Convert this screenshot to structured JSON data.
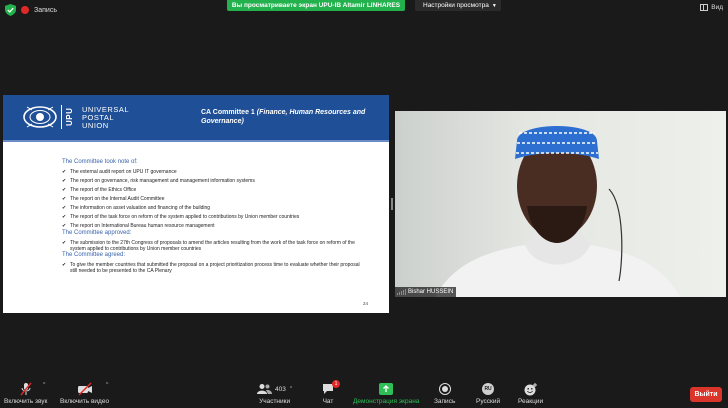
{
  "topbar": {
    "record_label": "Запись",
    "share_banner": "Вы просматриваете экран UPU-IB Altamir LINHARES",
    "view_options": "Настройки просмотра",
    "view_label": "Вид"
  },
  "slide": {
    "logo_abbr": "UPU",
    "logo_name_lines": [
      "UNIVERSAL",
      "POSTAL",
      "UNION"
    ],
    "title_main": "CA Committee 1 ",
    "title_sub": "(Finance, Human Resources and Governance)",
    "sections": [
      {
        "heading": "The Committee took note of:",
        "items": [
          "The external audit report on UPU IT governance",
          "The report on governance, risk management and management information systems",
          "The report of the Ethics Office",
          "The report on the Internal Audit Committee",
          "The information on asset valuation and financing of the building",
          "The report of the task force on reform of the system applied to contributions by Union member countries",
          "The report on International Bureau human resource management"
        ]
      },
      {
        "heading": "The Committee approved:",
        "items": [
          "The submission to the 27th Congress of proposals to amend the articles resulting from the work of the task force on reform of the system applied to contributions by Union member countries"
        ]
      },
      {
        "heading": "The Committee agreed:",
        "items": [
          "To give the member countries that submitted the proposal on a project prioritization process time to evaluate whether their proposal still needed to be presented to the CA Plenary"
        ]
      }
    ],
    "page_number": "24"
  },
  "video": {
    "participant_name": "Bishar HUSSEIN"
  },
  "toolbar": {
    "audio_label": "Включить звук",
    "video_label": "Включить видео",
    "participants_label": "Участники",
    "participants_count": "403",
    "chat_label": "Чат",
    "chat_badge": "1",
    "share_label": "Демонстрация экрана",
    "record_label": "Запись",
    "lang_code": "RU",
    "lang_label": "Русский",
    "reactions_label": "Реакции",
    "leave_label": "Выйти"
  },
  "colors": {
    "slide_header": "#1f4f96",
    "share_green": "#23b14d",
    "leave_red": "#d9352b",
    "section_blue": "#3a63ac"
  }
}
